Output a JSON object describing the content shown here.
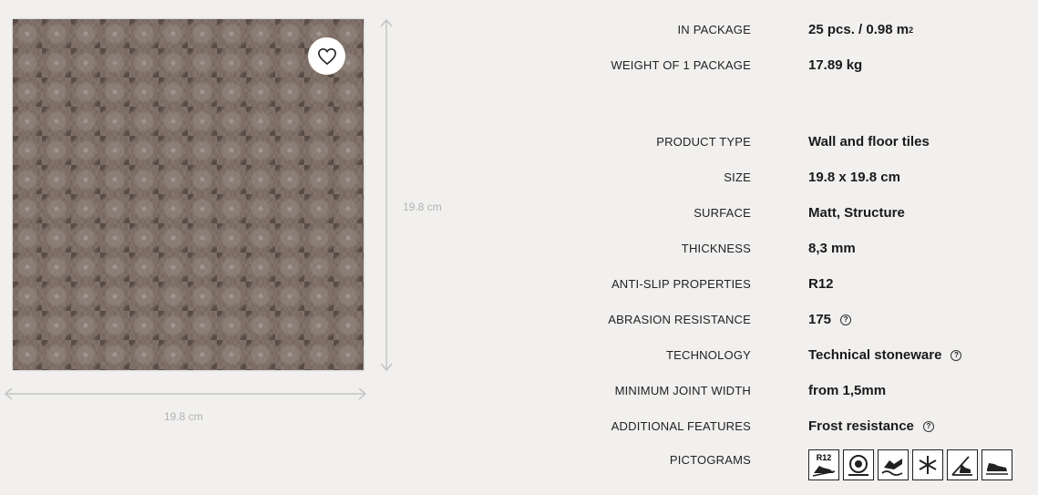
{
  "product": {
    "size_label_vertical": "19.8 cm",
    "size_label_horizontal": "19.8 cm",
    "favorite_icon": "heart-icon"
  },
  "specs": [
    {
      "label": "IN PACKAGE",
      "value": "25 pcs. / 0.98 m",
      "sup": "2"
    },
    {
      "label": "WEIGHT OF 1 PACKAGE",
      "value": "17.89 kg"
    },
    {
      "label": "PRODUCT TYPE",
      "value": "Wall and floor tiles"
    },
    {
      "label": "SIZE",
      "value": "19.8 x 19.8 cm"
    },
    {
      "label": "SURFACE",
      "value": "Matt, Structure"
    },
    {
      "label": "THICKNESS",
      "value": "8,3 mm"
    },
    {
      "label": "ANTI-SLIP PROPERTIES",
      "value": "R12"
    },
    {
      "label": "ABRASION RESISTANCE",
      "value": "175",
      "help": "?"
    },
    {
      "label": "TECHNOLOGY",
      "value": "Technical stoneware",
      "help": "?"
    },
    {
      "label": "MINIMUM JOINT WIDTH",
      "value": "from 1,5mm"
    },
    {
      "label": "ADDITIONAL FEATURES",
      "value": "Frost resistance",
      "help": "?"
    },
    {
      "label": "PICTOGRAMS"
    }
  ],
  "pictograms": [
    {
      "name": "anti-slip-r12-icon",
      "text": "R12"
    },
    {
      "name": "abrasion-icon"
    },
    {
      "name": "wet-floor-icon"
    },
    {
      "name": "frost-resistance-icon"
    },
    {
      "name": "slip-angle-icon"
    },
    {
      "name": "shoe-icon"
    }
  ],
  "colors": {
    "background": "#f1f0ef",
    "tile": "#7d6e66"
  }
}
